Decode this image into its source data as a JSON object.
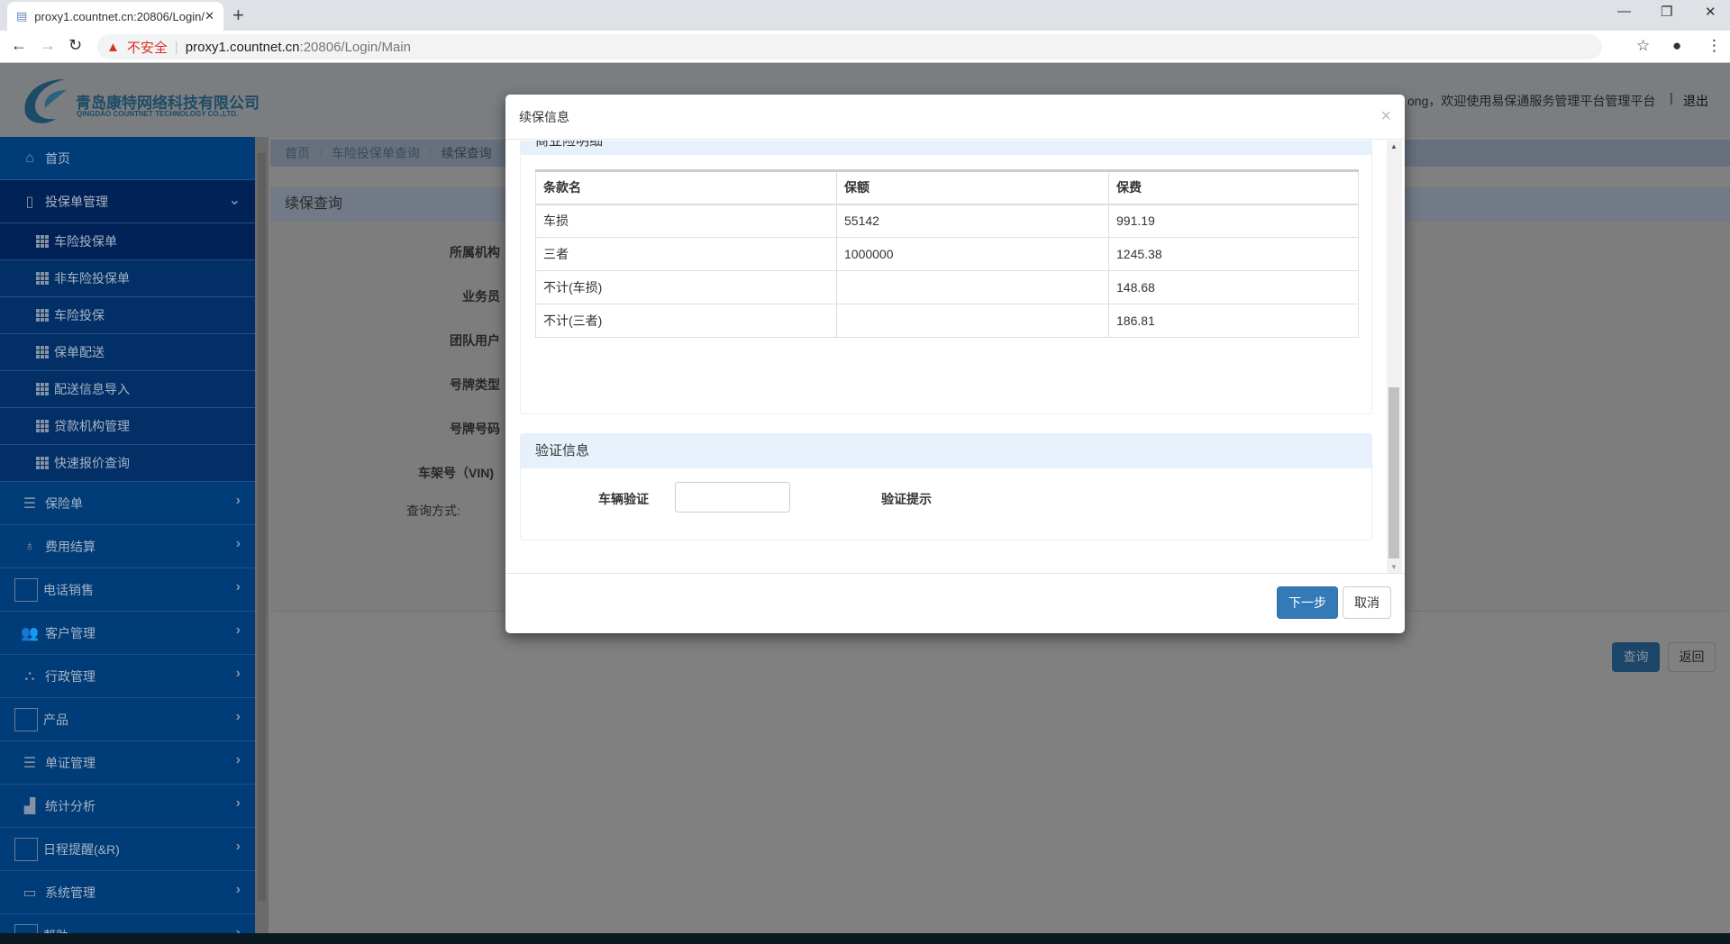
{
  "browser": {
    "tab_title": "proxy1.countnet.cn:20806/Login/Main",
    "insecure_label": "不安全",
    "url_host": "proxy1.countnet.cn",
    "url_rest": ":20806/Login/Main"
  },
  "header": {
    "company_cn": "青岛康特网络科技有限公司",
    "company_en": "QINGDAO COUNTNET TECHNOLOGY CO.,LTD.",
    "welcome": "ong，欢迎使用易保通服务管理平台管理平台",
    "logout": "退出"
  },
  "sidebar": {
    "home": "首页",
    "group_open": "投保单管理",
    "sub_items": [
      "车险投保单",
      "非车险投保单",
      "车险投保",
      "保单配送",
      "配送信息导入",
      "贷款机构管理",
      "快速报价查询"
    ],
    "items": [
      {
        "label": "保险单",
        "icon": "list-icon"
      },
      {
        "label": "费用结算",
        "icon": "money-bag-icon"
      },
      {
        "label": "电话销售",
        "icon": "empty-icon"
      },
      {
        "label": "客户管理",
        "icon": "users-icon"
      },
      {
        "label": "行政管理",
        "icon": "group-icon"
      },
      {
        "label": "产品",
        "icon": "empty-icon"
      },
      {
        "label": "单证管理",
        "icon": "list-icon"
      },
      {
        "label": "统计分析",
        "icon": "chart-icon"
      },
      {
        "label": "日程提醒(&R)",
        "icon": "empty-icon"
      },
      {
        "label": "系统管理",
        "icon": "laptop-icon"
      },
      {
        "label": "帮助",
        "icon": "empty-icon"
      }
    ]
  },
  "breadcrumb": [
    "首页",
    "车险投保单查询",
    "续保查询"
  ],
  "panel": {
    "title": "续保查询",
    "labels": [
      "所属机构",
      "业务员",
      "团队用户",
      "号牌类型",
      "号牌号码",
      "车架号（VIN)",
      "查询方式:"
    ],
    "query": "查询",
    "back": "返回"
  },
  "modal": {
    "title": "续保信息",
    "section1": "商业险明细",
    "columns": [
      "条款名",
      "保额",
      "保费"
    ],
    "rows": [
      [
        "车损",
        "55142",
        "991.19"
      ],
      [
        "三者",
        "1000000",
        "1245.38"
      ],
      [
        "不计(车损)",
        "",
        "148.68"
      ],
      [
        "不计(三者)",
        "",
        "186.81"
      ]
    ],
    "section2": "验证信息",
    "verify_label": "车辆验证",
    "verify_value": "",
    "hint_label": "验证提示",
    "next": "下一步",
    "cancel": "取消"
  }
}
